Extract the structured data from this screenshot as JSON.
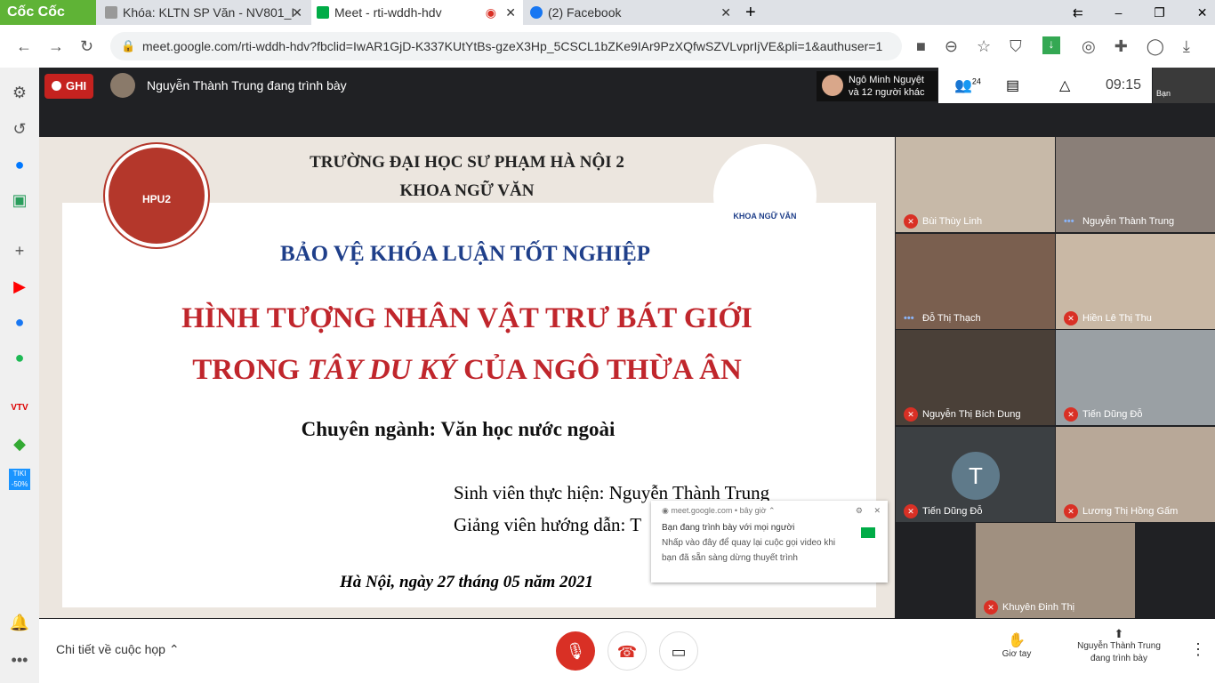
{
  "browser": {
    "brand": "Cốc Cốc",
    "tabs": [
      {
        "title": "Khóa: KLTN SP Văn - NV801_I"
      },
      {
        "title": "Meet - rti-wddh-hdv",
        "active": true
      },
      {
        "title": "(2) Facebook"
      }
    ],
    "url": "meet.google.com/rti-wddh-hdv?fbclid=IwAR1GjD-K337KUtYtBs-gzeX3Hp_5CSCL1bZKe9IAr9PzXQfwSZVLvprIjVE&pli=1&authuser=1"
  },
  "meet": {
    "record_label": "GHI",
    "presenter_text": "Nguyễn Thành Trung đang trình bày",
    "viewers": {
      "line1": "Ngô Minh Nguyệt",
      "line2": "và 12 người khác"
    },
    "participant_count": "24",
    "time": "09:15",
    "self_label": "Bạn"
  },
  "slide": {
    "school": "TRƯỜNG ĐẠI HỌC SƯ PHẠM HÀ NỘI 2",
    "faculty": "KHOA NGỮ VĂN",
    "heading": "BẢO VỆ KHÓA LUẬN TỐT NGHIỆP",
    "title1": "HÌNH TƯỢNG NHÂN VẬT TRƯ BÁT GIỚI",
    "title2_a": "TRONG ",
    "title2_b": "TÂY DU KÝ",
    "title2_c": " CỦA NGÔ THỪA ÂN",
    "major": "Chuyên ngành: Văn học nước ngoài",
    "student": "Sinh viên thực hiện: Nguyễn Thành Trung",
    "advisor": "Giảng viên hướng dẫn: T",
    "date": "Hà Nội, ngày 27 tháng 05 năm 2021",
    "logo_left": "HPU2",
    "logo_right": "KHOA NGỮ VĂN"
  },
  "participants": [
    {
      "name": "Bùi Thùy Linh",
      "muted": true
    },
    {
      "name": "Nguyễn Thành Trung",
      "muted": false
    },
    {
      "name": "Đỗ Thị Thạch",
      "muted": false
    },
    {
      "name": "Hiền Lê Thị Thu",
      "muted": true
    },
    {
      "name": "Nguyễn Thị Bích Dung",
      "muted": true
    },
    {
      "name": "Tiến Dũng Đỗ",
      "muted": true
    },
    {
      "name": "Tiến Dũng Đỗ",
      "muted": true,
      "avatar": "T"
    },
    {
      "name": "Lương Thị Hồng Gấm",
      "muted": true
    },
    {
      "name": "Khuyên Đinh Thị",
      "muted": true
    }
  ],
  "notification": {
    "source": "meet.google.com",
    "time": "bây giờ",
    "title": "Bạn đang trình bày với mọi người",
    "line1": "Nhấp vào đây để quay lại cuộc gọi video khi",
    "line2": "bạn đã sẵn sàng dừng thuyết trình"
  },
  "bottom": {
    "details": "Chi tiết về cuộc họp",
    "raise_hand": "Giơ tay",
    "presenting_line1": "Nguyễn Thành Trung",
    "presenting_line2": "đang trình bày"
  },
  "colors": {
    "accent_red": "#d93025",
    "meet_bg": "#202124",
    "slide_red": "#c0262c",
    "slide_blue": "#1f3f8a"
  }
}
